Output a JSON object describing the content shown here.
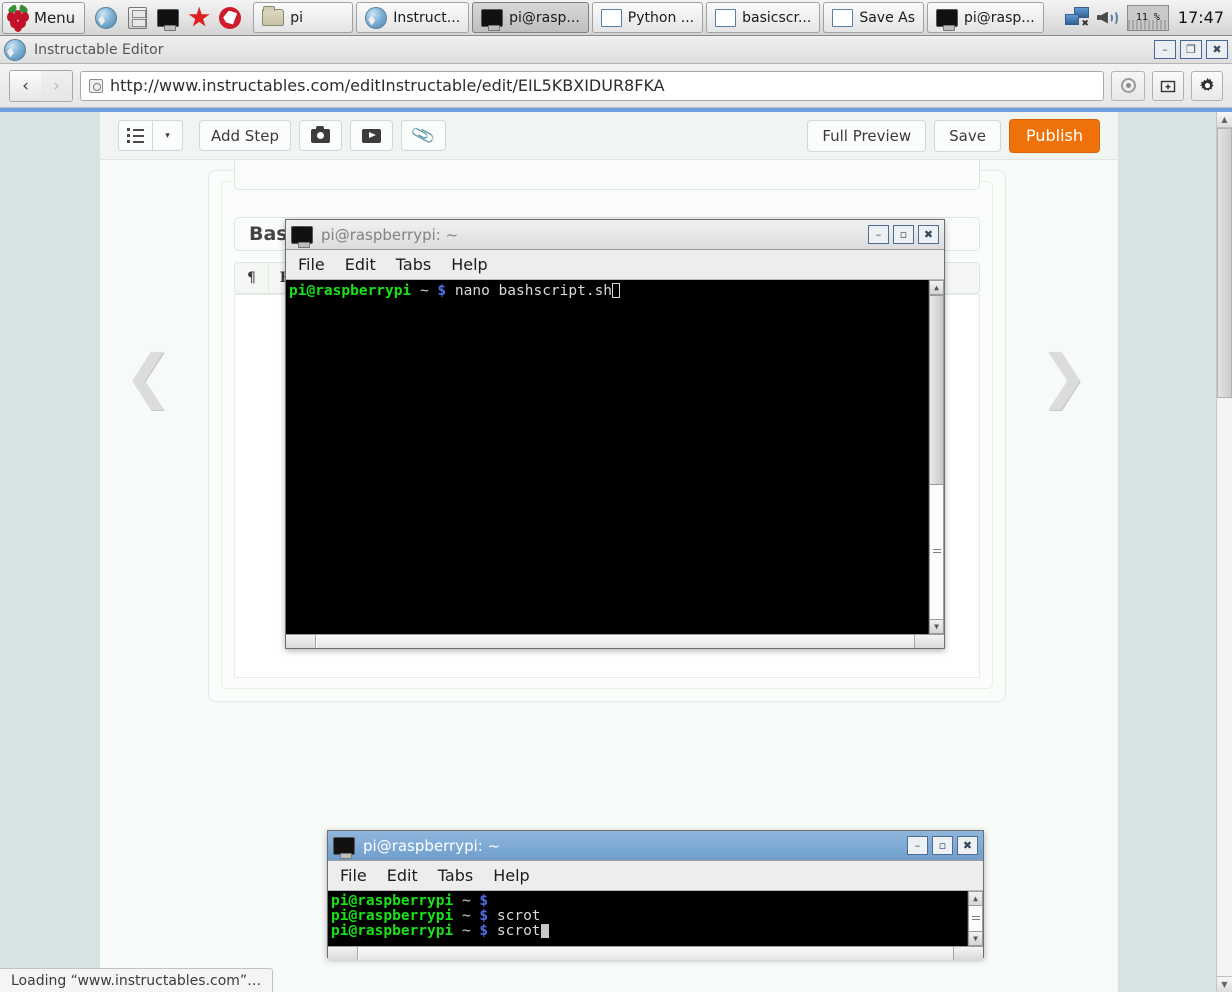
{
  "taskbar": {
    "menu_label": "Menu",
    "launchers": [
      {
        "name": "web-browser-launcher",
        "icon": "globe-icon"
      },
      {
        "name": "file-manager-launcher",
        "icon": "file-cabinet-icon"
      },
      {
        "name": "terminal-launcher",
        "icon": "terminal-icon"
      },
      {
        "name": "mathematica-launcher",
        "icon": "red-star-icon"
      },
      {
        "name": "wolfram-launcher",
        "icon": "red-circle-fox-icon"
      }
    ],
    "windows": [
      {
        "label": "pi",
        "icon": "folder-icon",
        "active": false
      },
      {
        "label": "Instruct...",
        "icon": "globe-icon",
        "active": false
      },
      {
        "label": "pi@rasp...",
        "icon": "terminal-icon",
        "active": true
      },
      {
        "label": "Python ...",
        "icon": "window-icon",
        "active": false
      },
      {
        "label": "basicscr...",
        "icon": "window-icon",
        "active": false
      },
      {
        "label": "Save As",
        "icon": "window-icon",
        "active": false
      },
      {
        "label": "pi@rasp...",
        "icon": "terminal-icon",
        "active": false
      }
    ],
    "tray": {
      "network_icon": "network-disconnected-icon",
      "volume_icon": "speaker-icon",
      "cpu_percent": "11 %",
      "clock": "17:47"
    }
  },
  "browser": {
    "window_title": "Instructable Editor",
    "window_buttons": {
      "minimize": "–",
      "restore": "❐",
      "close": "✖"
    },
    "back_label": "‹",
    "forward_label": "›",
    "url": "http://www.instructables.com/editInstructable/edit/EIL5KBXIDUR8FKA",
    "stop_icon": "stop-reload-icon",
    "newtab_icon": "new-tab-icon",
    "settings_icon": "gear-icon",
    "status_text": "Loading “www.instructables.com”…",
    "progress_color": "#6d9fe0"
  },
  "editor": {
    "toolbar": {
      "list_icon": "bullet-list-icon",
      "dropdown_caret": "▾",
      "add_step_label": "Add Step",
      "photo_icon": "camera-icon",
      "video_icon": "video-icon",
      "attach_icon": "paperclip-icon",
      "full_preview_label": "Full Preview",
      "save_label": "Save",
      "publish_label": "Publish",
      "publish_color": "#ee7209"
    },
    "step": {
      "step_title": "Bash s",
      "rte_buttons": [
        {
          "name": "paragraph-format-button",
          "glyph": "¶"
        },
        {
          "name": "bold-button",
          "glyph": "B"
        }
      ]
    },
    "nav_prev_icon": "chevron-left-icon",
    "nav_next_icon": "chevron-right-icon"
  },
  "terminal_top": {
    "title": "pi@raspberrypi: ~",
    "icon": "terminal-icon",
    "menu": [
      "File",
      "Edit",
      "Tabs",
      "Help"
    ],
    "buttons": {
      "minimize": "–",
      "maximize": "▫",
      "close": "✖"
    },
    "lines": [
      {
        "user": "pi@raspberrypi",
        "path": "~",
        "prompt": "$",
        "command": "nano bashscript.sh",
        "cursor": "hollow"
      }
    ]
  },
  "terminal_bottom": {
    "title": "pi@raspberrypi: ~",
    "icon": "terminal-icon",
    "menu": [
      "File",
      "Edit",
      "Tabs",
      "Help"
    ],
    "buttons": {
      "minimize": "–",
      "maximize": "▫",
      "close": "✖"
    },
    "lines": [
      {
        "user": "pi@raspberrypi",
        "path": "~",
        "prompt": "$",
        "command": "",
        "cursor": "none"
      },
      {
        "user": "pi@raspberrypi",
        "path": "~",
        "prompt": "$",
        "command": "scrot",
        "cursor": "none"
      },
      {
        "user": "pi@raspberrypi",
        "path": "~",
        "prompt": "$",
        "command": "scrot",
        "cursor": "block"
      }
    ]
  }
}
